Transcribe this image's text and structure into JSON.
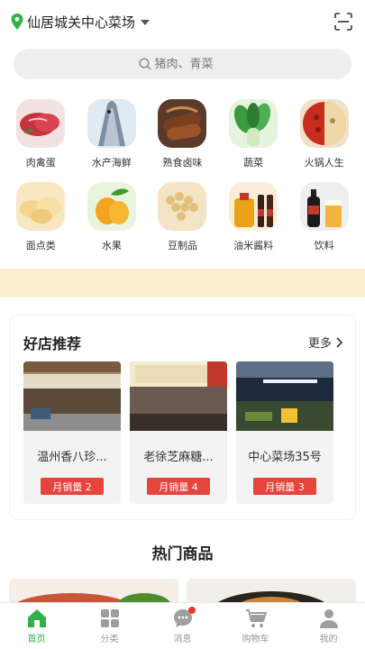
{
  "header": {
    "location": "仙居城关中心菜场",
    "icons": {
      "location": "location-pin-icon",
      "dropdown": "chevron-down-icon",
      "scan": "scan-icon"
    }
  },
  "search": {
    "placeholder": "猪肉、青菜"
  },
  "categories": [
    {
      "label": "肉禽蛋",
      "icon": "meat-image"
    },
    {
      "label": "水产海鲜",
      "icon": "fish-image"
    },
    {
      "label": "熟食卤味",
      "icon": "braised-meat-image"
    },
    {
      "label": "蔬菜",
      "icon": "vegetable-image"
    },
    {
      "label": "火锅人生",
      "icon": "hotpot-image"
    },
    {
      "label": "面点类",
      "icon": "bread-image"
    },
    {
      "label": "水果",
      "icon": "fruit-image"
    },
    {
      "label": "豆制品",
      "icon": "soybean-image"
    },
    {
      "label": "油米酱料",
      "icon": "oil-sauce-image"
    },
    {
      "label": "饮料",
      "icon": "drink-image"
    }
  ],
  "shops": {
    "title": "好店推荐",
    "more_label": "更多",
    "items": [
      {
        "name": "温州香八珍...",
        "sales": "月销量 2"
      },
      {
        "name": "老徐芝麻糖...",
        "sales": "月销量 4"
      },
      {
        "name": "中心菜场35号",
        "sales": "月销量 3"
      }
    ]
  },
  "hot": {
    "title": "热门商品"
  },
  "tabbar": [
    {
      "label": "首页",
      "icon": "home-icon",
      "active": true
    },
    {
      "label": "分类",
      "icon": "category-icon"
    },
    {
      "label": "消息",
      "icon": "message-icon"
    },
    {
      "label": "购物车",
      "icon": "cart-icon"
    },
    {
      "label": "我的",
      "icon": "user-icon"
    }
  ],
  "colors": {
    "accent": "#2fb24a",
    "badge": "#e6443d",
    "banner": "#fbedd0"
  }
}
